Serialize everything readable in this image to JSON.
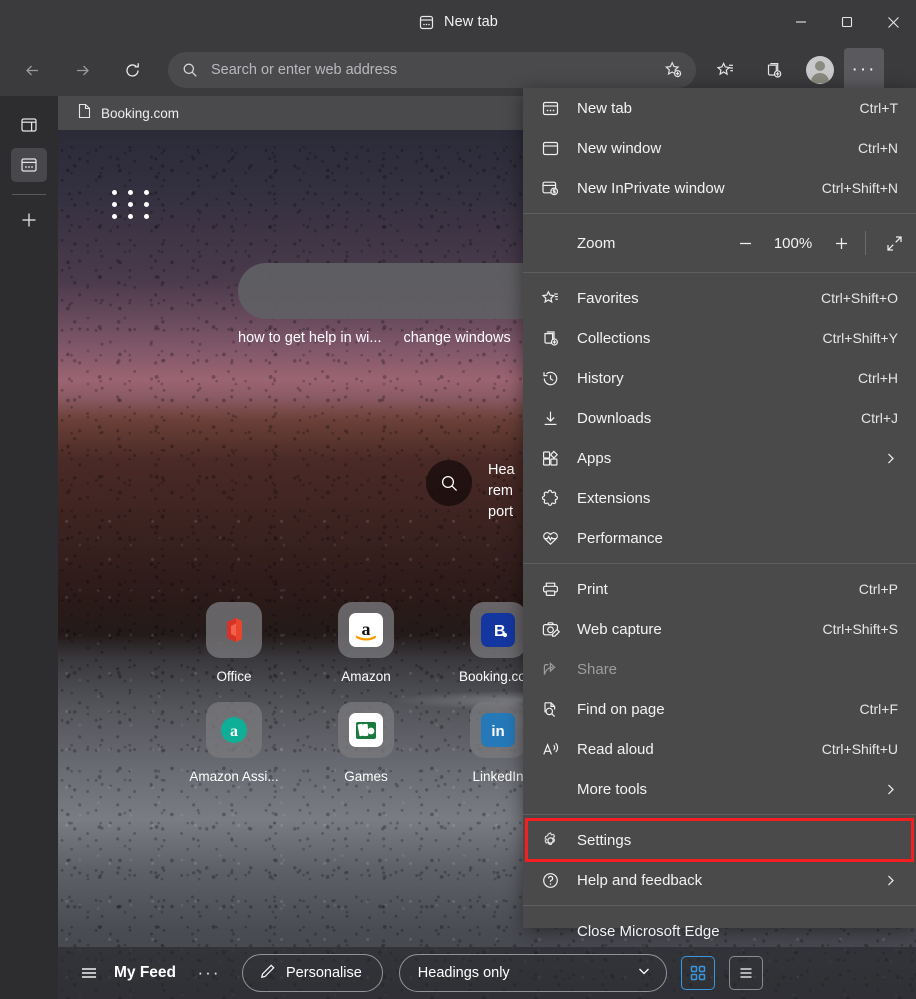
{
  "window": {
    "tab_title": "New tab",
    "tab_favicon": "newtab-icon",
    "minimize_label": "Minimize",
    "maximize_label": "Maximize",
    "close_label": "Close"
  },
  "toolbar": {
    "back_label": "Back",
    "forward_label": "Forward",
    "refresh_label": "Refresh",
    "address_placeholder": "Search or enter web address",
    "address_value": "",
    "add_favorite_label": "Add this page to favorites",
    "favorites_label": "Favorites",
    "collections_label": "Collections",
    "profile_label": "Profile",
    "settings_more_label": "Settings and more",
    "settings_more_glyph": "···"
  },
  "rail": {
    "items": [
      {
        "name": "browser-essentials",
        "label": "Browser essentials",
        "selected": false
      },
      {
        "name": "tab-actions",
        "label": "Tab actions",
        "selected": true
      },
      {
        "name": "add-tool",
        "label": "Add",
        "selected": false
      }
    ]
  },
  "bookmarks": {
    "items": [
      {
        "label": "Booking.com",
        "icon": "page-icon"
      }
    ]
  },
  "newtab": {
    "apps_grid_label": "App launcher",
    "search_placeholder": "",
    "trending": [
      "how to get help in wi...",
      "change windows"
    ],
    "promo": {
      "icon": "search-icon",
      "lines": [
        "Hea",
        "rem",
        "port"
      ]
    },
    "shortcuts": [
      {
        "label": "Office",
        "icon": "office-icon"
      },
      {
        "label": "Amazon",
        "icon": "amazon-icon"
      },
      {
        "label": "Booking.com",
        "icon": "booking-icon"
      },
      {
        "label": "Amazon Assi...",
        "icon": "amazon-assistant-icon"
      },
      {
        "label": "Games",
        "icon": "games-icon"
      },
      {
        "label": "LinkedIn",
        "icon": "linkedin-icon"
      }
    ]
  },
  "feedbar": {
    "menu_icon": "hamburger-icon",
    "title": "My Feed",
    "more_glyph": "···",
    "personalise_label": "Personalise",
    "personalise_icon": "pencil-icon",
    "layout_value": "Headings only",
    "grid_view_label": "Grid view",
    "list_view_label": "List view"
  },
  "menu": {
    "groups": [
      {
        "items": [
          {
            "label": "New tab",
            "accel": "Ctrl+T",
            "icon": "new-tab-icon",
            "chevron": false,
            "disabled": false
          },
          {
            "label": "New window",
            "accel": "Ctrl+N",
            "icon": "new-window-icon",
            "chevron": false,
            "disabled": false
          },
          {
            "label": "New InPrivate window",
            "accel": "Ctrl+Shift+N",
            "icon": "inprivate-icon",
            "chevron": false,
            "disabled": false
          }
        ]
      },
      {
        "zoom": {
          "label": "Zoom",
          "value": "100%",
          "minus_label": "Zoom out",
          "plus_label": "Zoom in",
          "fullscreen_label": "Full screen"
        }
      },
      {
        "items": [
          {
            "label": "Favorites",
            "accel": "Ctrl+Shift+O",
            "icon": "favorites-icon",
            "chevron": false,
            "disabled": false
          },
          {
            "label": "Collections",
            "accel": "Ctrl+Shift+Y",
            "icon": "collections-icon",
            "chevron": false,
            "disabled": false
          },
          {
            "label": "History",
            "accel": "Ctrl+H",
            "icon": "history-icon",
            "chevron": false,
            "disabled": false
          },
          {
            "label": "Downloads",
            "accel": "Ctrl+J",
            "icon": "downloads-icon",
            "chevron": false,
            "disabled": false
          },
          {
            "label": "Apps",
            "accel": "",
            "icon": "apps-icon",
            "chevron": true,
            "disabled": false
          },
          {
            "label": "Extensions",
            "accel": "",
            "icon": "extensions-icon",
            "chevron": false,
            "disabled": false
          },
          {
            "label": "Performance",
            "accel": "",
            "icon": "performance-icon",
            "chevron": false,
            "disabled": false
          }
        ]
      },
      {
        "items": [
          {
            "label": "Print",
            "accel": "Ctrl+P",
            "icon": "print-icon",
            "chevron": false,
            "disabled": false
          },
          {
            "label": "Web capture",
            "accel": "Ctrl+Shift+S",
            "icon": "web-capture-icon",
            "chevron": false,
            "disabled": false
          },
          {
            "label": "Share",
            "accel": "",
            "icon": "share-icon",
            "chevron": false,
            "disabled": true
          },
          {
            "label": "Find on page",
            "accel": "Ctrl+F",
            "icon": "find-icon",
            "chevron": false,
            "disabled": false
          },
          {
            "label": "Read aloud",
            "accel": "Ctrl+Shift+U",
            "icon": "read-aloud-icon",
            "chevron": false,
            "disabled": false
          },
          {
            "label": "More tools",
            "accel": "",
            "icon": "",
            "chevron": true,
            "disabled": false
          }
        ]
      },
      {
        "items": [
          {
            "label": "Settings",
            "accel": "",
            "icon": "gear-icon",
            "chevron": false,
            "disabled": false,
            "highlighted": true
          },
          {
            "label": "Help and feedback",
            "accel": "",
            "icon": "help-icon",
            "chevron": true,
            "disabled": false
          }
        ]
      },
      {
        "items": [
          {
            "label": "Close Microsoft Edge",
            "accel": "",
            "icon": "",
            "chevron": false,
            "disabled": false
          }
        ]
      }
    ],
    "highlight_color": "#f51f22"
  }
}
